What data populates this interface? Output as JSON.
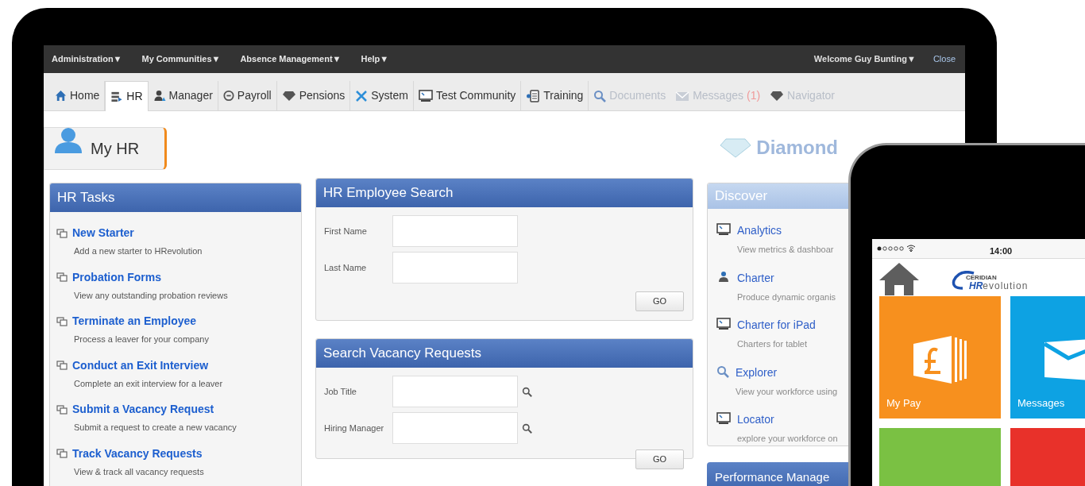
{
  "top_menu": [
    {
      "label": "Administration▼"
    },
    {
      "label": "My Communities▼"
    },
    {
      "label": "Absence Management▼"
    },
    {
      "label": "Help▼"
    }
  ],
  "user_menu": {
    "welcome": "Welcome Guy Bunting▼",
    "close": "Close"
  },
  "tabs": [
    {
      "label": "Home",
      "kind": "tab",
      "selected": false
    },
    {
      "label": "HR",
      "kind": "tab",
      "selected": true
    },
    {
      "label": "Manager",
      "kind": "tab",
      "selected": false
    },
    {
      "label": "Payroll",
      "kind": "tab",
      "selected": false
    },
    {
      "label": "Pensions",
      "kind": "tab",
      "selected": false
    },
    {
      "label": "System",
      "kind": "tab",
      "selected": false
    },
    {
      "label": "Test Community",
      "kind": "tab",
      "selected": false
    },
    {
      "label": "Training",
      "kind": "tab",
      "selected": false
    },
    {
      "label": "Documents",
      "kind": "plain",
      "selected": false
    },
    {
      "label": "Messages",
      "badge": "(1)",
      "kind": "plain",
      "selected": false
    },
    {
      "label": "Navigator",
      "kind": "plain",
      "selected": false
    }
  ],
  "page_title": "My HR",
  "brand": "Diamond",
  "hr_tasks": {
    "title": "HR Tasks",
    "items": [
      {
        "title": "New Starter",
        "description": "Add a new starter to HRevolution"
      },
      {
        "title": "Probation Forms",
        "description": "View any outstanding probation reviews"
      },
      {
        "title": "Terminate an Employee",
        "description": "Process a leaver for your company"
      },
      {
        "title": "Conduct an Exit Interview",
        "description": "Complete an exit interview for a leaver"
      },
      {
        "title": "Submit a Vacancy Request",
        "description": "Submit a request to create a new vacancy"
      },
      {
        "title": "Track Vacancy Requests",
        "description": "View & track all vacancy requests"
      }
    ]
  },
  "employee_search": {
    "title": "HR Employee Search",
    "fields": [
      {
        "label": "First Name",
        "lookup": false
      },
      {
        "label": "Last Name",
        "lookup": false
      }
    ],
    "button": "GO"
  },
  "vacancy_search": {
    "title": "Search Vacancy Requests",
    "fields": [
      {
        "label": "Job Title",
        "lookup": true
      },
      {
        "label": "Hiring Manager",
        "lookup": true
      }
    ],
    "button": "GO"
  },
  "discover": {
    "title": "Discover",
    "items": [
      {
        "title": "Analytics",
        "description": "View metrics & dashboar"
      },
      {
        "title": "Charter",
        "description": "Produce dynamic organis"
      },
      {
        "title": "Charter for iPad",
        "description": "Charters for tablet"
      },
      {
        "title": "Explorer",
        "description": "View your workforce using"
      },
      {
        "title": "Locator",
        "description": "explore your workforce on"
      }
    ]
  },
  "performance": {
    "title": "Performance Manage"
  },
  "phone": {
    "time": "14:00",
    "logo_top": "CERIDIAN",
    "logo_bold": "HR",
    "logo_rest": "evolution",
    "tiles": [
      {
        "label": "My Pay",
        "color": "#f7901e"
      },
      {
        "label": "Messages",
        "color": "#0da2e3"
      },
      {
        "color": "#7ac143"
      },
      {
        "color": "#e8312a"
      }
    ]
  }
}
